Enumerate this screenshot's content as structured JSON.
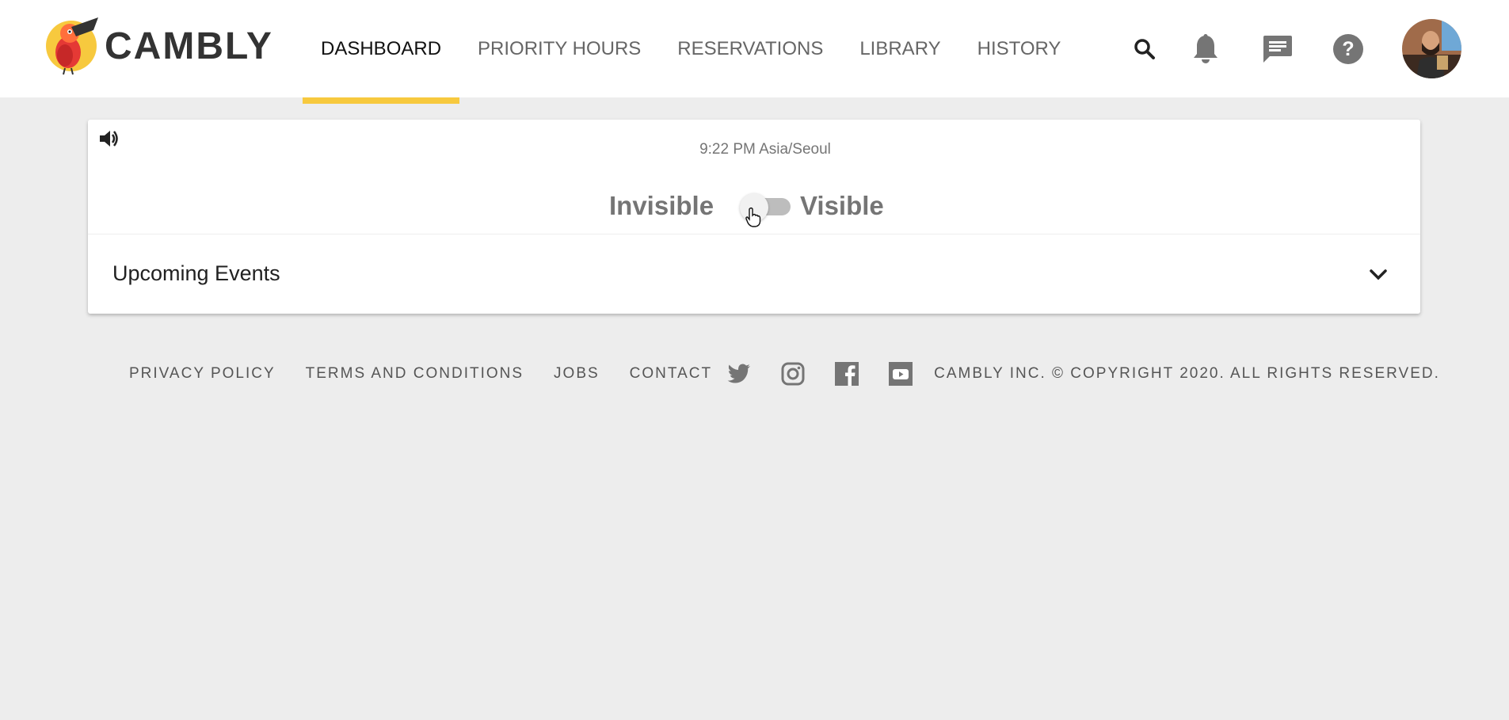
{
  "brand": {
    "name": "CAMBLY",
    "logo_icon": "toucan-logo-icon"
  },
  "nav": {
    "items": [
      {
        "label": "DASHBOARD",
        "active": true
      },
      {
        "label": "PRIORITY HOURS",
        "active": false
      },
      {
        "label": "RESERVATIONS",
        "active": false
      },
      {
        "label": "LIBRARY",
        "active": false
      },
      {
        "label": "HISTORY",
        "active": false
      }
    ],
    "active_underline_color": "#f7c93e"
  },
  "header_icons": [
    "search-icon",
    "bell-icon",
    "chat-icon",
    "help-icon",
    "avatar"
  ],
  "card": {
    "sound_icon": "volume-icon",
    "time": "9:22 PM Asia/Seoul",
    "visibility": {
      "off_label": "Invisible",
      "on_label": "Visible",
      "is_visible": false
    },
    "upcoming_events": {
      "title": "Upcoming Events",
      "expanded": false
    }
  },
  "footer": {
    "links": [
      "PRIVACY POLICY",
      "TERMS AND CONDITIONS",
      "JOBS",
      "CONTACT"
    ],
    "social": [
      "twitter-icon",
      "instagram-icon",
      "facebook-icon",
      "youtube-icon"
    ],
    "copyright": "CAMBLY INC. © COPYRIGHT 2020. ALL RIGHTS RESERVED."
  }
}
